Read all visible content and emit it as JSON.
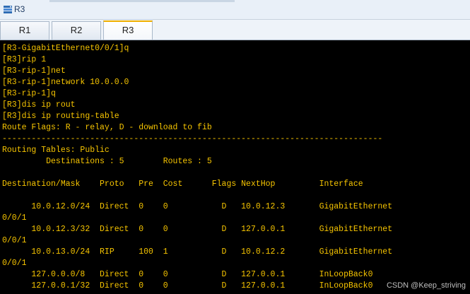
{
  "window": {
    "title": "R3"
  },
  "tabs": [
    {
      "label": "R1"
    },
    {
      "label": "R2"
    },
    {
      "label": "R3",
      "active": true
    }
  ],
  "terminal": {
    "text_color": "#f7c500",
    "background": "#000000",
    "lines": [
      "[R3-GigabitEthernet0/0/1]q",
      "[R3]rip 1",
      "[R3-rip-1]net",
      "[R3-rip-1]network 10.0.0.0",
      "[R3-rip-1]q",
      "[R3]dis ip rout",
      "[R3]dis ip routing-table",
      "Route Flags: R - relay, D - download to fib",
      "------------------------------------------------------------------------------",
      "Routing Tables: Public",
      "         Destinations : 5        Routes : 5",
      "",
      "Destination/Mask    Proto   Pre  Cost      Flags NextHop         Interface",
      "",
      "      10.0.12.0/24  Direct  0    0           D   10.0.12.3       GigabitEthernet",
      "0/0/1",
      "      10.0.12.3/32  Direct  0    0           D   127.0.0.1       GigabitEthernet",
      "0/0/1",
      "      10.0.13.0/24  RIP     100  1           D   10.0.12.2       GigabitEthernet",
      "0/0/1",
      "      127.0.0.0/8   Direct  0    0           D   127.0.0.1       InLoopBack0",
      "      127.0.0.1/32  Direct  0    0           D   127.0.0.1       InLoopBack0"
    ]
  },
  "watermark": "CSDN @Keep_striving"
}
